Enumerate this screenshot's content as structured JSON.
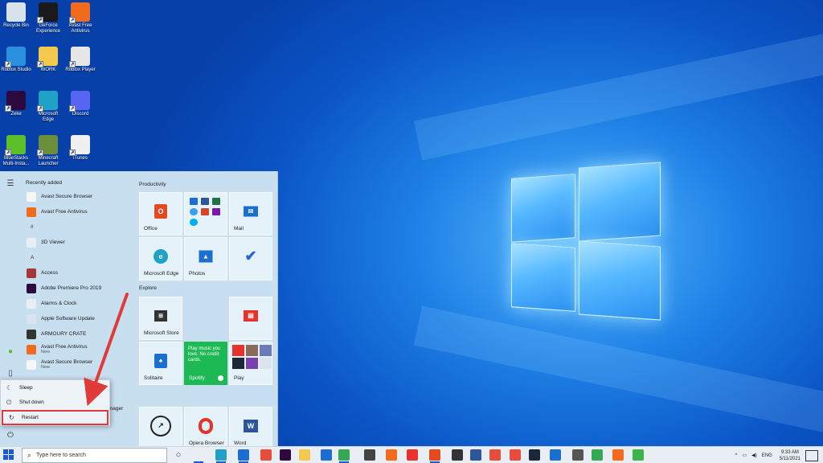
{
  "desktop": {
    "icons": [
      {
        "label": "Recycle Bin",
        "icon": "recycle-bin-icon",
        "color": "#d8e3ec"
      },
      {
        "label": "GeForce Experience",
        "icon": "geforce-icon",
        "color": "#1a1a1a"
      },
      {
        "label": "Avast Free Antivirus",
        "icon": "avast-icon",
        "color": "#f26b1d"
      },
      {
        "label": "Roblox Studio",
        "icon": "roblox-studio-icon",
        "color": "#2b8fe0"
      },
      {
        "label": "WORK",
        "icon": "folder-icon",
        "color": "#f2c94c"
      },
      {
        "label": "Roblox Player",
        "icon": "roblox-player-icon",
        "color": "#e6e6e6"
      },
      {
        "label": "Zeke",
        "icon": "premiere-pro-icon",
        "color": "#2d0a3d"
      },
      {
        "label": "Microsoft Edge",
        "icon": "edge-icon",
        "color": "#1fa2c8"
      },
      {
        "label": "Discord",
        "icon": "discord-icon",
        "color": "#5865f2"
      },
      {
        "label": "BlueStacks Multi-Insta...",
        "icon": "bluestacks-icon",
        "color": "#5cbf2a"
      },
      {
        "label": "Minecraft Launcher",
        "icon": "minecraft-icon",
        "color": "#6b8e3a"
      },
      {
        "label": "iTunes",
        "icon": "itunes-icon",
        "color": "#f0f0f0"
      }
    ]
  },
  "start_menu": {
    "recently_added": "Recently added",
    "apps": [
      {
        "kind": "app",
        "label": "Avast Secure Browser",
        "icon": "avast-secure-browser-icon",
        "color": "#f6f6f6"
      },
      {
        "kind": "app",
        "label": "Avast Free Antivirus",
        "icon": "avast-icon",
        "color": "#f26b1d"
      },
      {
        "kind": "letter",
        "label": "#"
      },
      {
        "kind": "app",
        "label": "3D Viewer",
        "icon": "3d-viewer-icon",
        "color": "#e8eef3"
      },
      {
        "kind": "letter",
        "label": "A"
      },
      {
        "kind": "app",
        "label": "Access",
        "icon": "access-icon",
        "color": "#a4373a"
      },
      {
        "kind": "app",
        "label": "Adobe Premiere Pro 2019",
        "icon": "premiere-pro-icon",
        "color": "#2d0a3d"
      },
      {
        "kind": "app",
        "label": "Alarms & Clock",
        "icon": "alarm-clock-icon",
        "color": "#e8eef3"
      },
      {
        "kind": "app",
        "label": "Apple Software Update",
        "icon": "apple-update-icon",
        "color": "#d9e4ee"
      },
      {
        "kind": "app",
        "label": "ARMOURY CRATE",
        "icon": "armoury-crate-icon",
        "color": "#333333"
      },
      {
        "kind": "app",
        "label": "Avast Free Antivirus",
        "sub": "New",
        "icon": "avast-icon",
        "color": "#f26b1d"
      },
      {
        "kind": "app",
        "label": "Avast Secure Browser",
        "sub": "New",
        "icon": "avast-secure-browser-icon",
        "color": "#f6f6f6"
      }
    ],
    "bottom_app": {
      "label": "BlueStacks Multi-Instance Manager",
      "icon": "bluestacks-icon",
      "color": "#5cbf2a"
    },
    "groups": {
      "productivity": "Productivity",
      "explore": "Explore"
    },
    "tiles": {
      "office": "Office",
      "mail": "Mail",
      "edge": "Microsoft Edge",
      "photos": "Photos",
      "store": "Microsoft Store",
      "solitaire": "Solitaire",
      "spotify_promo": "Play music you love. No credit cards.",
      "spotify": "Spotify",
      "play": "Play",
      "opera": "Opera Browser",
      "word": "Word"
    }
  },
  "power_menu": {
    "sleep": "Sleep",
    "shutdown": "Shut down",
    "restart": "Restart"
  },
  "taskbar": {
    "search_placeholder": "Type here to search",
    "language": "ENG",
    "time": "9:33 AM",
    "date": "5/11/2021",
    "apps": [
      {
        "icon": "task-view-icon",
        "color": "#e8eef3"
      },
      {
        "icon": "edge-icon",
        "color": "#1fa2c8"
      },
      {
        "icon": "mail-icon",
        "color": "#1a6fd1"
      },
      {
        "icon": "camtasia-icon",
        "color": "#e74c3c"
      },
      {
        "icon": "premiere-pro-icon",
        "color": "#2d0a3d"
      },
      {
        "icon": "file-explorer-icon",
        "color": "#f2c94c"
      },
      {
        "icon": "calendar-icon",
        "color": "#1a6fd1"
      },
      {
        "icon": "chrome-icon",
        "color": "#34a853"
      },
      {
        "icon": "store-icon",
        "color": "#444444"
      },
      {
        "icon": "app-orange-icon",
        "color": "#f26b1d"
      },
      {
        "icon": "opera-icon",
        "color": "#e6322b"
      },
      {
        "icon": "office-icon",
        "color": "#e34a1f"
      },
      {
        "icon": "store-bag-icon",
        "color": "#333333"
      },
      {
        "icon": "word-icon",
        "color": "#2b579a"
      },
      {
        "icon": "snagit-icon",
        "color": "#e74c3c"
      },
      {
        "icon": "camtasia-recorder-icon",
        "color": "#e74c3c"
      },
      {
        "icon": "steam-icon",
        "color": "#1b2838"
      },
      {
        "icon": "remote-icon",
        "color": "#1a6fd1"
      },
      {
        "icon": "display-icon",
        "color": "#555555"
      },
      {
        "icon": "chrome-alt-icon",
        "color": "#34a853"
      },
      {
        "icon": "avast-browser-icon",
        "color": "#f26b1d"
      },
      {
        "icon": "camtasia-c-icon",
        "color": "#3bb54a"
      }
    ]
  }
}
